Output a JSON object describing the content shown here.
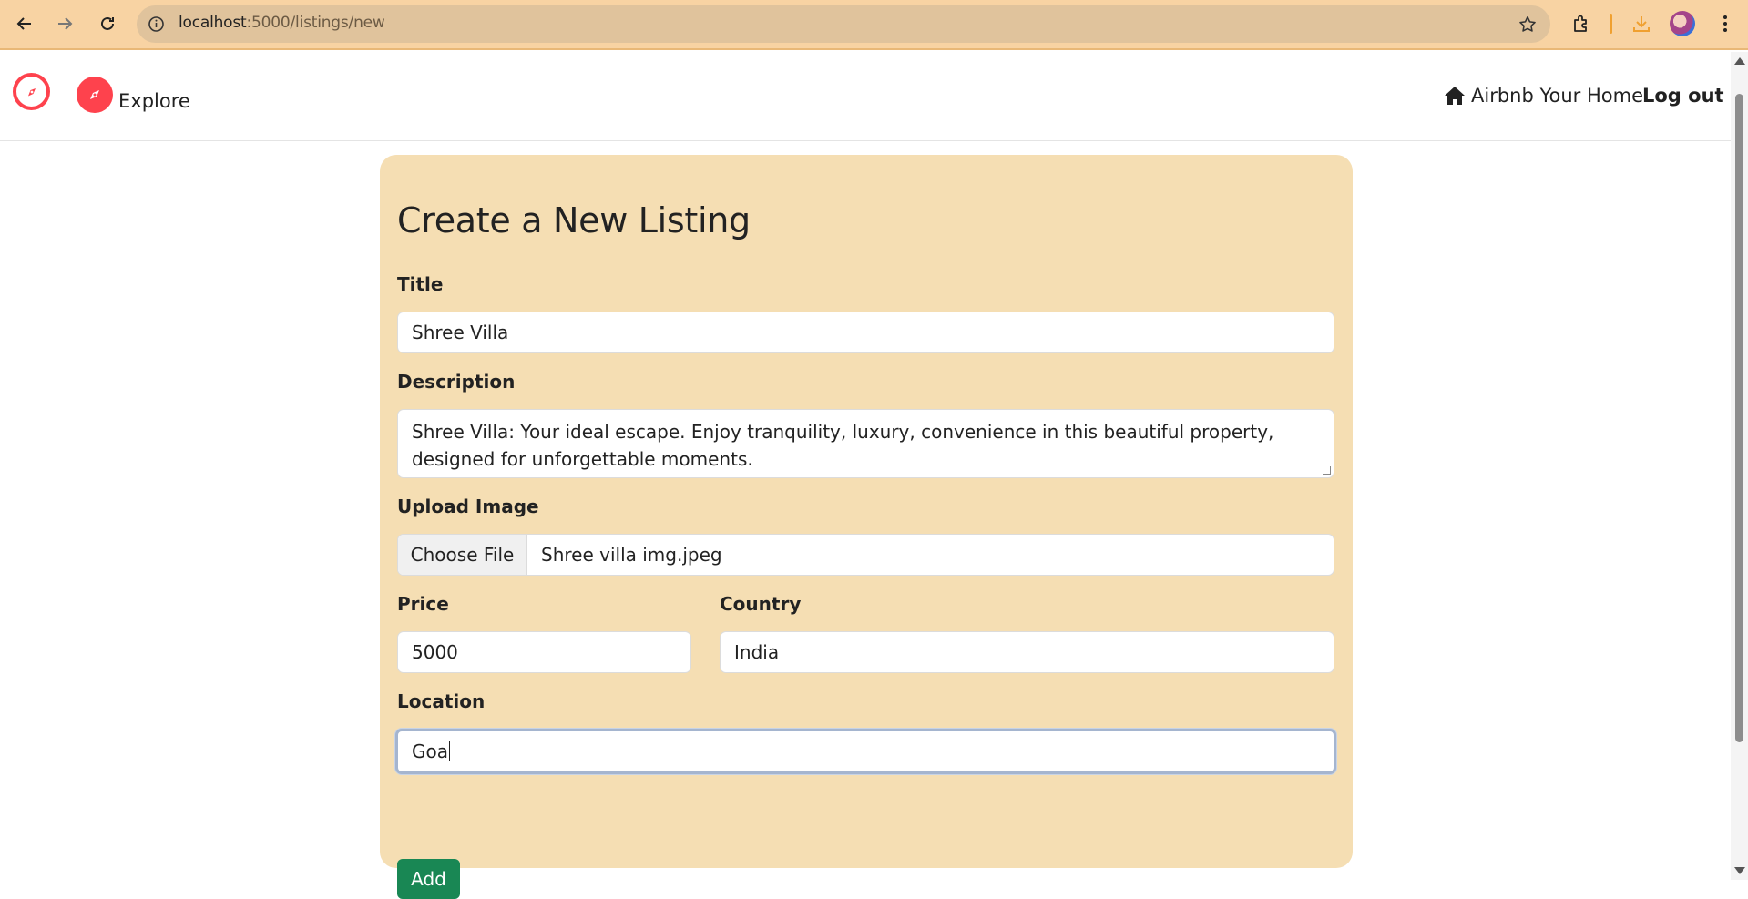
{
  "browser": {
    "url_host": "localhost",
    "url_path": ":5000/listings/new",
    "icons": [
      "back-arrow-icon",
      "forward-arrow-icon",
      "reload-icon",
      "site-info-icon",
      "bookmark-star-icon",
      "extensions-icon",
      "download-icon",
      "profile-avatar",
      "menu-dots-icon"
    ]
  },
  "navbar": {
    "explore_label": "Explore",
    "host_label": "Airbnb Your Home",
    "logout_label": "Log out",
    "brand_color": "#fe424d"
  },
  "form": {
    "heading": "Create a New Listing",
    "title_label": "Title",
    "title_value": "Shree Villa",
    "description_label": "Description",
    "description_value": "Shree Villa: Your ideal escape. Enjoy tranquility, luxury, convenience in this beautiful property, designed for unforgettable moments.",
    "image_label": "Upload Image",
    "choose_file_label": "Choose File",
    "file_name": "Shree villa img.jpeg",
    "price_label": "Price",
    "price_value": "5000",
    "country_label": "Country",
    "country_value": "India",
    "location_label": "Location",
    "location_value": "Goa",
    "submit_label": "Add",
    "card_color": "#f5deb3",
    "submit_color": "#198754"
  }
}
